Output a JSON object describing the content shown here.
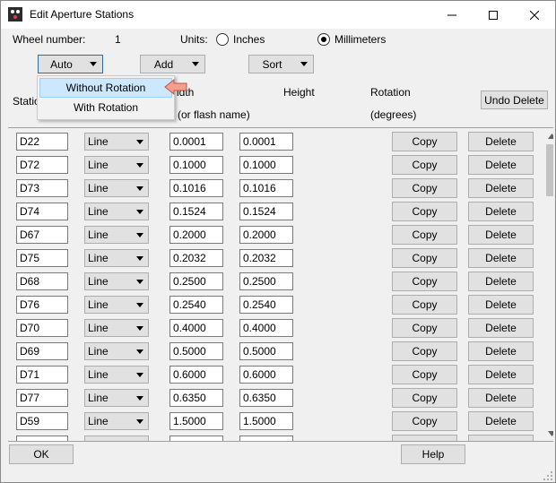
{
  "window": {
    "title": "Edit Aperture Stations",
    "minimize_glyph": "—",
    "maximize_glyph": "☐",
    "close_glyph": "✕"
  },
  "header": {
    "wheel_label": "Wheel number:",
    "wheel_value": "1",
    "units_label": "Units:",
    "unit_inches": "Inches",
    "unit_millimeters": "Millimeters",
    "selected_unit": "Millimeters"
  },
  "toolbar": {
    "auto_label": "Auto",
    "add_label": "Add",
    "sort_label": "Sort",
    "undo_delete_label": "Undo Delete"
  },
  "auto_menu": {
    "items": [
      {
        "label": "Without Rotation",
        "highlighted": true
      },
      {
        "label": "With Rotation",
        "highlighted": false
      }
    ]
  },
  "columns": {
    "station": "Statio",
    "width_top": "idth",
    "width_sub": "(or flash name)",
    "height": "Height",
    "rotation": "Rotation",
    "rotation_sub": "(degrees)"
  },
  "row_actions": {
    "copy_label": "Copy",
    "delete_label": "Delete"
  },
  "rows": [
    {
      "station": "D22",
      "shape": "Line",
      "width": "0.0001",
      "height": "0.0001"
    },
    {
      "station": "D72",
      "shape": "Line",
      "width": "0.1000",
      "height": "0.1000"
    },
    {
      "station": "D73",
      "shape": "Line",
      "width": "0.1016",
      "height": "0.1016"
    },
    {
      "station": "D74",
      "shape": "Line",
      "width": "0.1524",
      "height": "0.1524"
    },
    {
      "station": "D67",
      "shape": "Line",
      "width": "0.2000",
      "height": "0.2000"
    },
    {
      "station": "D75",
      "shape": "Line",
      "width": "0.2032",
      "height": "0.2032"
    },
    {
      "station": "D68",
      "shape": "Line",
      "width": "0.2500",
      "height": "0.2500"
    },
    {
      "station": "D76",
      "shape": "Line",
      "width": "0.2540",
      "height": "0.2540"
    },
    {
      "station": "D70",
      "shape": "Line",
      "width": "0.4000",
      "height": "0.4000"
    },
    {
      "station": "D69",
      "shape": "Line",
      "width": "0.5000",
      "height": "0.5000"
    },
    {
      "station": "D71",
      "shape": "Line",
      "width": "0.6000",
      "height": "0.6000"
    },
    {
      "station": "D77",
      "shape": "Line",
      "width": "0.6350",
      "height": "0.6350"
    },
    {
      "station": "D59",
      "shape": "Line",
      "width": "1.5000",
      "height": "1.5000"
    }
  ],
  "footer": {
    "ok_label": "OK",
    "help_label": "Help"
  },
  "colors": {
    "menu_highlight": "#cce8ff",
    "focus_border": "#0078d7",
    "pointer_arrow": "#f4a08a"
  }
}
